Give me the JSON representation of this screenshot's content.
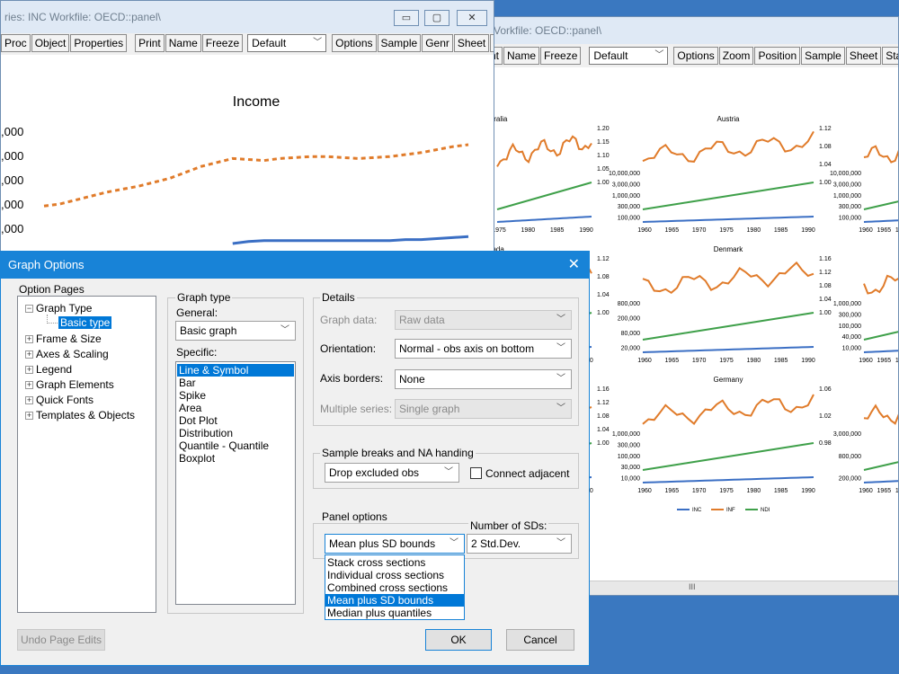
{
  "left_window": {
    "title": "ries: INC   Workfile: OECD::panel\\",
    "toolbar": [
      "Proc",
      "Object",
      "Properties",
      "Print",
      "Name",
      "Freeze"
    ],
    "toolbar_combo": "Default",
    "toolbar2": [
      "Options",
      "Sample",
      "Genr",
      "Sheet",
      "S"
    ],
    "controls": {
      "minimize": "▭",
      "maximize": "▢",
      "close": "✕"
    }
  },
  "right_window": {
    "title": "Vorkfile: OECD::panel\\",
    "toolbar": [
      "nt",
      "Name",
      "Freeze"
    ],
    "toolbar_combo": "Default",
    "toolbar2": [
      "Options",
      "Zoom",
      "Position",
      "Sample",
      "Sheet",
      "Sta"
    ],
    "scroll_marker": "III"
  },
  "income_chart": {
    "chart_data": {
      "type": "line",
      "title": "Income",
      "ytick_labels": [
        ",000",
        ",000",
        ",000",
        ",000",
        ",000"
      ],
      "series": [
        {
          "name": "",
          "color": "#e07b2a",
          "style": "dashed",
          "values": [
            38,
            40,
            44,
            48,
            52,
            55,
            58,
            62,
            66,
            72,
            78,
            82,
            86,
            85,
            84,
            86,
            87,
            88,
            88,
            87,
            86,
            87,
            88,
            90,
            92,
            95,
            98,
            100
          ]
        },
        {
          "name": "",
          "color": "#3b6fc4",
          "style": "solid",
          "values": [
            0,
            0,
            0,
            0,
            0,
            0,
            0,
            0,
            0,
            0,
            0,
            0,
            0,
            2,
            3,
            3,
            3,
            3,
            3,
            3,
            3,
            3,
            3,
            4,
            4,
            5,
            6,
            7
          ]
        }
      ]
    }
  },
  "panel_charts": {
    "years": [
      "1960",
      "1965",
      "1970",
      "1975",
      "1980",
      "1985",
      "1990"
    ],
    "years_partial": [
      "1975",
      "1980",
      "1985",
      "1990"
    ],
    "legend": [
      "INC",
      "INF",
      "NDI"
    ],
    "colors": {
      "INC": "#3b6fc4",
      "INF": "#e07b2a",
      "NDI": "#3fa04a"
    },
    "panels": [
      {
        "title": "stralia",
        "left_ticks": [],
        "right_ticks": [
          "1.20",
          "1.15",
          "1.10",
          "1.05",
          "1.00"
        ]
      },
      {
        "title": "Austria",
        "left_ticks": [
          "10,000,000",
          "3,000,000",
          "1,000,000",
          "300,000",
          "100,000"
        ],
        "right_ticks": [
          "1.12",
          "1.08",
          "1.04",
          "1.00"
        ]
      },
      {
        "title": "",
        "left_ticks": [
          "10,000,000",
          "3,000,000",
          "1,000,000",
          "300,000",
          "100,000"
        ],
        "right_ticks": []
      },
      {
        "title": "nada",
        "left_ticks": [],
        "right_ticks": [
          "1.12",
          "1.08",
          "1.04",
          "1.00"
        ]
      },
      {
        "title": "Denmark",
        "left_ticks": [
          "800,000",
          "200,000",
          "80,000",
          "20,000"
        ],
        "right_ticks": [
          "1.16",
          "1.12",
          "1.08",
          "1.04",
          "1.00"
        ]
      },
      {
        "title": "",
        "left_ticks": [
          "1,000,000",
          "300,000",
          "100,000",
          "40,000",
          "10,000"
        ],
        "right_ticks": []
      },
      {
        "title": "",
        "left_ticks": [],
        "right_ticks": [
          "1.16",
          "1.12",
          "1.08",
          "1.04",
          "1.00"
        ]
      },
      {
        "title": "Germany",
        "left_ticks": [
          "1,000,000",
          "300,000",
          "100,000",
          "30,000",
          "10,000"
        ],
        "right_ticks": [
          "1.06",
          "1.02",
          "0.98"
        ]
      },
      {
        "title": "",
        "left_ticks": [
          "3,000,000",
          "800,000",
          "200,000"
        ],
        "right_ticks": []
      }
    ]
  },
  "dialog": {
    "title": "Graph Options",
    "close": "✕",
    "option_pages_label": "Option Pages",
    "tree": [
      {
        "label": "Graph Type",
        "expanded": true
      },
      {
        "label": "Basic type",
        "child": true,
        "selected": true
      },
      {
        "label": "Frame & Size"
      },
      {
        "label": "Axes & Scaling"
      },
      {
        "label": "Legend"
      },
      {
        "label": "Graph Elements"
      },
      {
        "label": "Quick Fonts"
      },
      {
        "label": "Templates & Objects"
      }
    ],
    "graph_type_label": "Graph type",
    "general_label": "General:",
    "general_value": "Basic graph",
    "specific_label": "Specific:",
    "specific_items": [
      "Line & Symbol",
      "Bar",
      "Spike",
      "Area",
      "Dot Plot",
      "Distribution",
      "Quantile - Quantile",
      "Boxplot"
    ],
    "specific_selected": "Line & Symbol",
    "details_label": "Details",
    "graph_data_label": "Graph data:",
    "graph_data_value": "Raw data",
    "orientation_label": "Orientation:",
    "orientation_value": "Normal - obs axis on bottom",
    "axis_borders_label": "Axis borders:",
    "axis_borders_value": "None",
    "multiple_series_label": "Multiple series:",
    "multiple_series_value": "Single graph",
    "sample_breaks_label": "Sample breaks and NA handing",
    "sample_breaks_value": "Drop excluded obs",
    "connect_adjacent_label": "Connect adjacent",
    "panel_options_label": "Panel options",
    "panel_options_value": "Mean plus SD bounds",
    "panel_options_items": [
      "Stack cross sections",
      "Individual cross sections",
      "Combined cross sections",
      "Mean plus SD bounds",
      "Median plus quantiles"
    ],
    "panel_options_selected": "Mean plus SD bounds",
    "num_sds_label": "Number of SDs:",
    "num_sds_value": "2 Std.Dev.",
    "undo_label": "Undo Page Edits",
    "ok_label": "OK",
    "cancel_label": "Cancel"
  }
}
